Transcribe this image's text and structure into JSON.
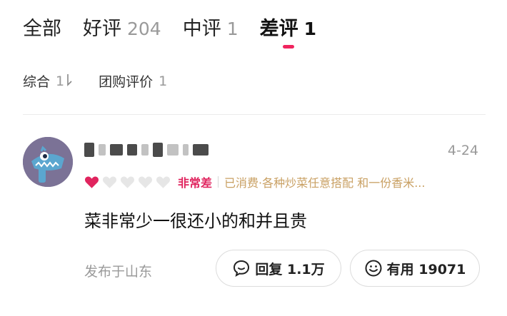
{
  "tabs": [
    {
      "label": "全部",
      "count": ""
    },
    {
      "label": "好评",
      "count": "204"
    },
    {
      "label": "中评",
      "count": "1"
    },
    {
      "label": "差评",
      "count": "1"
    }
  ],
  "active_tab": "差评",
  "filters": [
    {
      "label": "综合",
      "count": "1"
    },
    {
      "label": "团购评价",
      "count": "1"
    }
  ],
  "review": {
    "date": "4-24",
    "rating_hearts": 1,
    "rating_max": 5,
    "rating_label": "非常差",
    "consumed": "已消费·各种炒菜任意搭配 和一份香米...",
    "content": "菜非常少一很还小的和并且贵",
    "location": "发布于山东",
    "reply_label": "回复 1.1万",
    "useful_label": "有用 19071"
  },
  "colors": {
    "accent": "#f0245e",
    "rating": "#e0245e",
    "consumed": "#c9a063",
    "avatar_bg": "#7b7296"
  }
}
